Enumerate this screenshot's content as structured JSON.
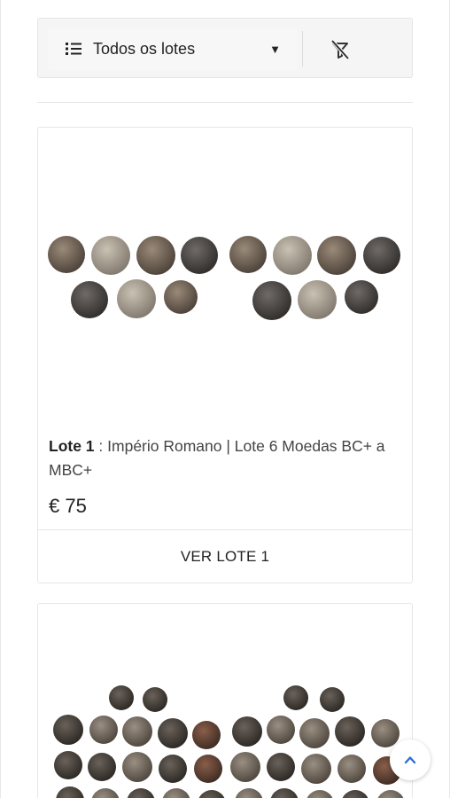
{
  "toolbar": {
    "filter_label": "Todos os lotes",
    "list_icon": "list-icon",
    "caret_icon": "caret-down-icon",
    "clear_filter_icon": "filter-off-icon"
  },
  "lots": [
    {
      "lot_prefix": "Lote 1",
      "separator": " : ",
      "title": "Império Romano | Lote 6 Moedas BC+ a MBC+",
      "price": "€ 75",
      "button_label": "VER LOTE 1"
    }
  ],
  "back_to_top_icon": "chevron-up-icon",
  "colors": {
    "accent": "#2b6fd6",
    "border": "#e6e6e6",
    "toolbar_bg": "#f5f5f5"
  }
}
